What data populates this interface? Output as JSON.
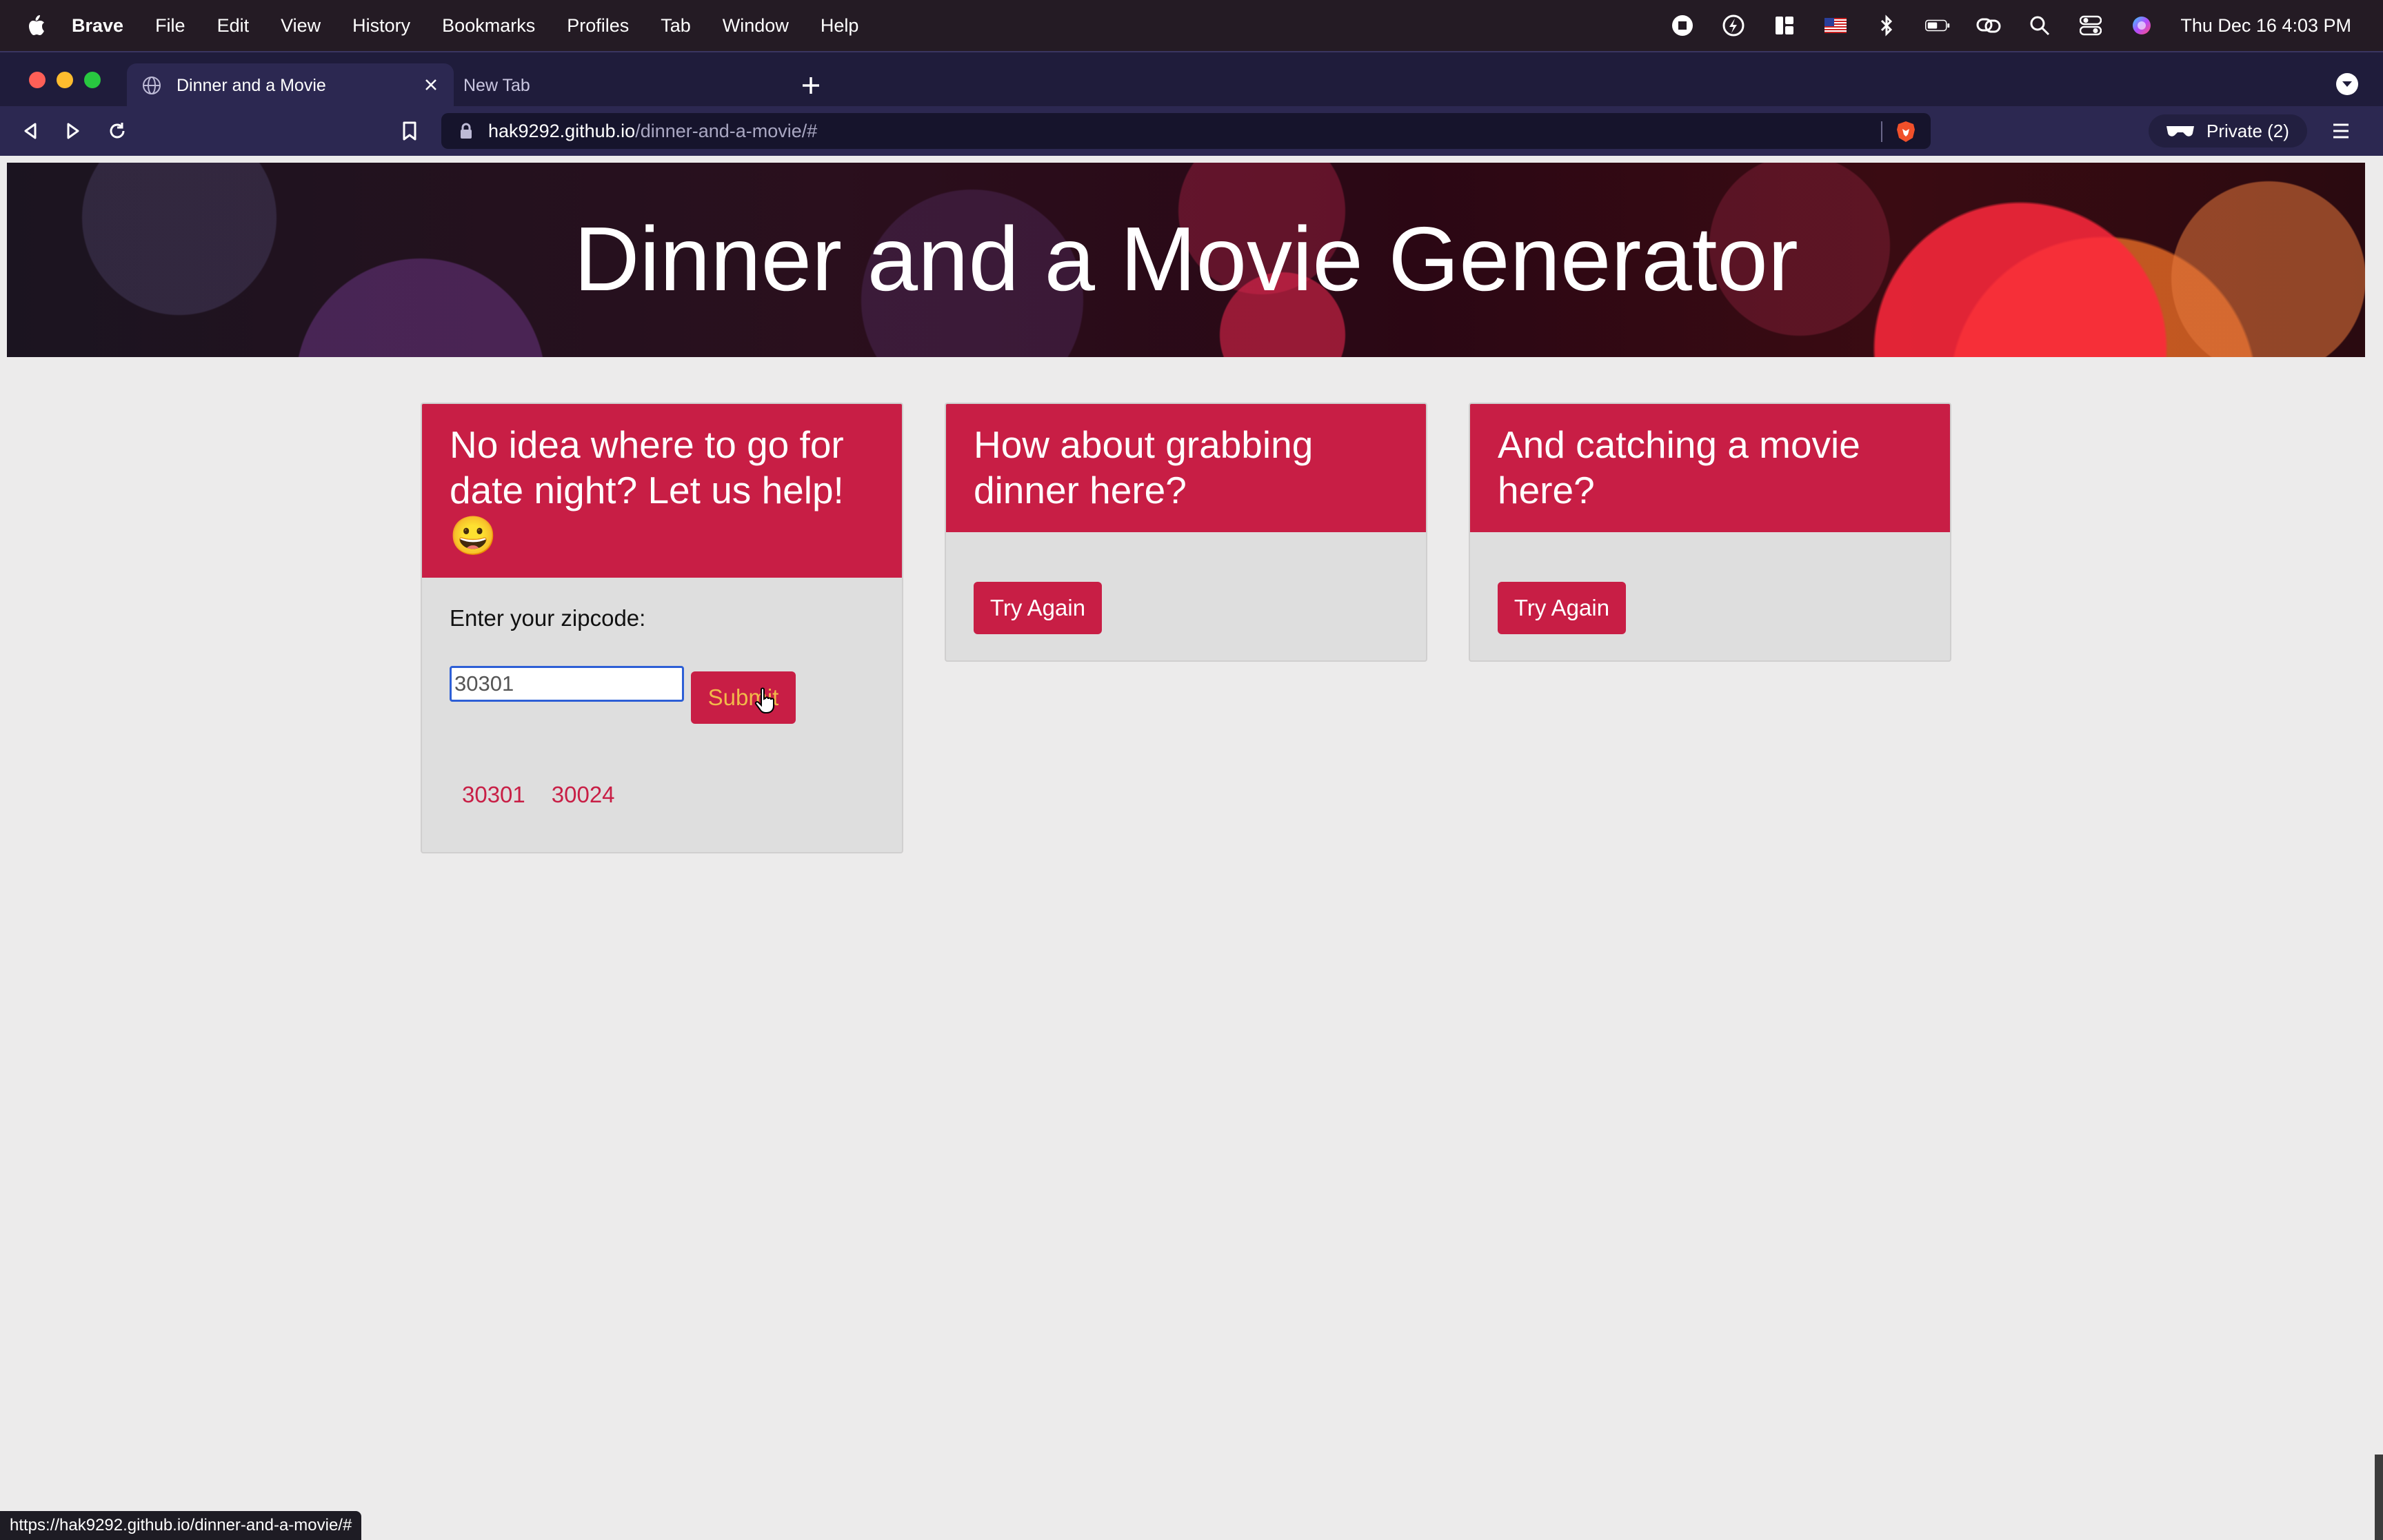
{
  "menubar": {
    "app_name": "Brave",
    "items": [
      "File",
      "Edit",
      "View",
      "History",
      "Bookmarks",
      "Profiles",
      "Tab",
      "Window",
      "Help"
    ],
    "clock": "Thu Dec 16  4:03 PM"
  },
  "browser": {
    "tabs": [
      {
        "title": "Dinner and a Movie",
        "active": true
      },
      {
        "title": "New Tab",
        "active": false
      }
    ],
    "url_host": "hak9292.github.io",
    "url_path": "/dinner-and-a-movie/#",
    "private_label": "Private (2)",
    "status_url": "https://hak9292.github.io/dinner-and-a-movie/#"
  },
  "page": {
    "title": "Dinner and a Movie Generator",
    "search_card": {
      "heading": "No idea where to go for date night? Let us help! 😀",
      "label": "Enter your zipcode:",
      "input_value": "30301",
      "submit_label": "Submit",
      "history": [
        "30301",
        "30024"
      ]
    },
    "dinner_card": {
      "heading": "How about grabbing dinner here?",
      "button_label": "Try Again"
    },
    "movie_card": {
      "heading": "And catching a movie here?",
      "button_label": "Try Again"
    }
  },
  "colors": {
    "accent": "#c81e45",
    "submit_text": "#f2b94a",
    "page_bg": "#ecebeb",
    "card_bg": "#dedede"
  }
}
